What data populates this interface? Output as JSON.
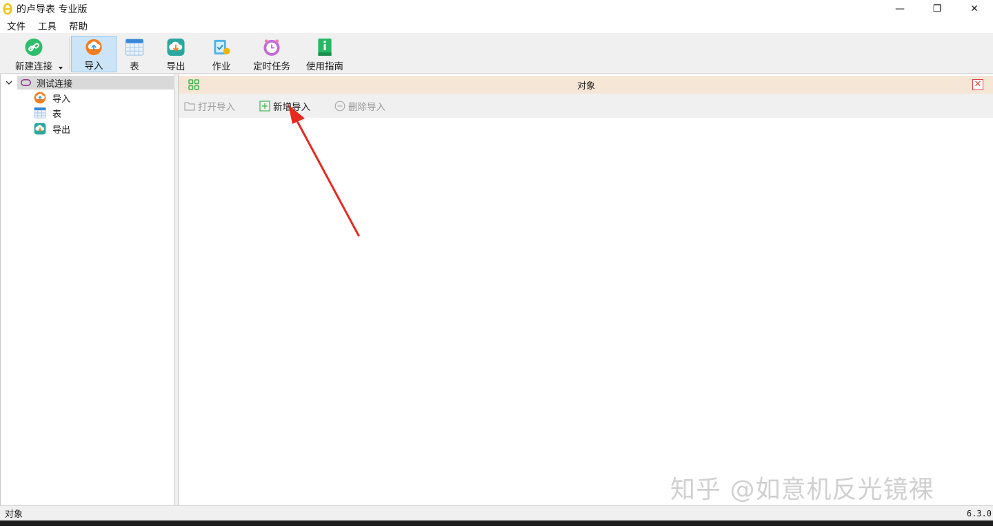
{
  "window": {
    "title": "的卢导表 专业版",
    "controls": {
      "minimize": "—",
      "maximize": "❐",
      "close": "✕"
    }
  },
  "menu": [
    "文件",
    "工具",
    "帮助"
  ],
  "toolbar": {
    "new_connection": "新建连接",
    "import": "导入",
    "table": "表",
    "export": "导出",
    "job": "作业",
    "scheduled_task": "定时任务",
    "guide": "使用指南"
  },
  "tree": {
    "root": "测试连接",
    "children": [
      "导入",
      "表",
      "导出"
    ]
  },
  "objects_panel": {
    "title": "对象",
    "close": "✕",
    "actions": {
      "open": "打开导入",
      "add": "新增导入",
      "delete": "删除导入"
    }
  },
  "watermark": "知乎 @如意机反光镜裸",
  "status": {
    "left": "对象",
    "version": "6.3.0"
  },
  "colors": {
    "accent_selected": "#cce4f7",
    "panel_header": "#f5e6d6",
    "close_red": "#e04040",
    "annotation_arrow": "#e8281e"
  }
}
